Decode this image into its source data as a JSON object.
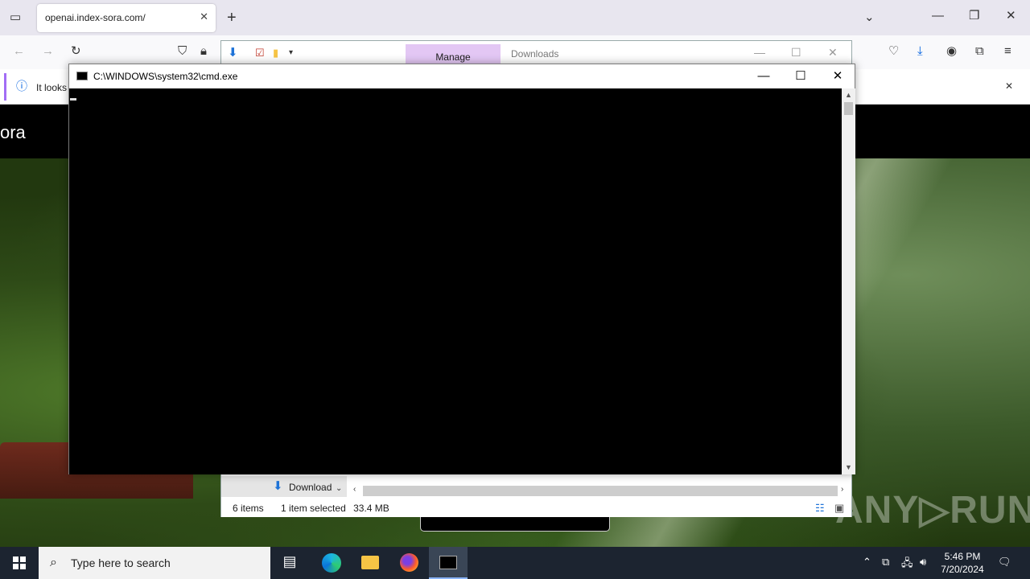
{
  "browser": {
    "tab_title": "openai.index-sora.com/",
    "tab_close": "✕",
    "new_tab": "+",
    "notification_text": "It looks",
    "notification_close": "✕",
    "site_brand": "ora"
  },
  "explorer": {
    "ribbon_tab_manage": "Manage",
    "ribbon_tab_downloads": "Downloads",
    "nav_item_label": "Download",
    "status_items": "6 items",
    "status_selected": "1 item selected",
    "status_size": "33.4 MB"
  },
  "cmd": {
    "title": "C:\\WINDOWS\\system32\\cmd.exe",
    "minimize": "—",
    "maximize": "☐",
    "close": "✕"
  },
  "taskbar": {
    "search_placeholder": "Type here to search",
    "time": "5:46 PM",
    "date": "7/20/2024"
  },
  "watermark": "ANY▷RUN"
}
